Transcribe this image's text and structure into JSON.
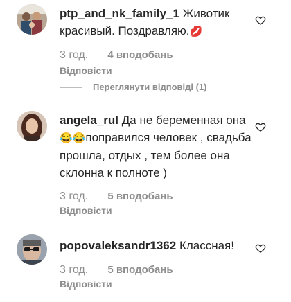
{
  "comments": [
    {
      "username": "ptp_and_nk_family_1",
      "text": "Животик красивый. Поздравляю.",
      "emoji": "💋",
      "time": "3 год.",
      "likes": "4 вподобань",
      "reply": "Відповісти",
      "avatar_icon": "family-photo-avatar"
    },
    {
      "username": "angela_rul",
      "text_part1": "Да не беременная она ",
      "emoji": "😂😂",
      "text_part2": "поправился человек , свадьба прошла, отдых , тем более она склонна к полноте )",
      "time": "3 год.",
      "likes": "5 вподобань",
      "reply": "Відповісти",
      "avatar_icon": "woman-photo-avatar"
    },
    {
      "username": "popovaleksandr1362",
      "text": "Классная!",
      "time": "3 год.",
      "likes": "5 вподобань",
      "reply": "Відповісти",
      "avatar_icon": "man-sunglasses-avatar"
    }
  ],
  "view_replies": "Переглянути відповіді (1)",
  "colors": {
    "text": "#262626",
    "muted": "#8e8e8e",
    "heart_stroke": "#262626"
  },
  "icons": {
    "like": "heart-outline-icon"
  }
}
